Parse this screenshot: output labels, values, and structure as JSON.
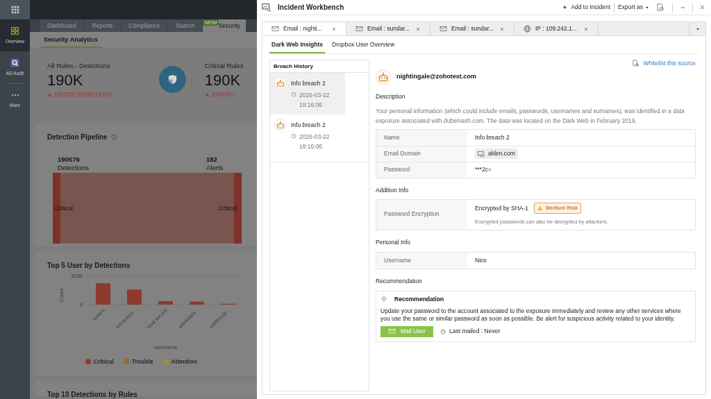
{
  "sidebar": {
    "items": [
      {
        "kind": "grid",
        "label": "Overview",
        "selected": true
      },
      {
        "kind": "audit",
        "label": "AD Audit",
        "selected": false
      },
      {
        "kind": "more",
        "label": "More",
        "selected": false
      }
    ]
  },
  "top_tabs": [
    {
      "label": "Dashboard",
      "selected": false
    },
    {
      "label": "Reports",
      "selected": false
    },
    {
      "label": "Compliance",
      "selected": false
    },
    {
      "label": "Search",
      "selected": false
    },
    {
      "label": "Security",
      "selected": true,
      "badge": "NEW"
    }
  ],
  "sub_tab": {
    "label": "Security Analytics",
    "selected": true
  },
  "kpis": [
    {
      "title": "All Rules - Detections",
      "value": "190K",
      "change": "190503 (260963.01%)"
    },
    {
      "title": "Critical Rules",
      "value": "190K",
      "change": "190489 ("
    }
  ],
  "pipeline": {
    "title": "Detection Pipeline",
    "left_count": "190576",
    "left_label": "Detections",
    "right_count": "182",
    "right_label": "Alerts",
    "left_node": "Critical",
    "right_node": "Critical"
  },
  "top_users": {
    "title": "Top 5 User by Detections",
    "chart_data": {
      "type": "bar",
      "xlabel": "Username",
      "ylabel": "Count",
      "categories": [
        "system",
        "anonymou...",
        "local service",
        "administra...",
        "o365mc@..."
      ],
      "series": [
        {
          "name": "Critical",
          "color": "#8e3a2f",
          "values": [
            2350,
            1650,
            380,
            330,
            100
          ]
        }
      ],
      "ylim": [
        0,
        3200
      ],
      "yticks": [
        0,
        3200
      ]
    },
    "legend_extra": [
      {
        "label": "Trouble",
        "color": "#9a6a2c"
      },
      {
        "label": "Attention",
        "color": "#a0902e"
      }
    ]
  },
  "next_card_title": "Top 10 Detections by Rules",
  "workbench": {
    "title": "Incident Workbench",
    "add_action": "Add to Incident",
    "export_action": "Export as",
    "entity_tabs": [
      {
        "kind": "email",
        "label": "Email : nighti...",
        "selected": true
      },
      {
        "kind": "email",
        "label": "Email : sundar...",
        "selected": false
      },
      {
        "kind": "email",
        "label": "Email : sundar...",
        "selected": false
      },
      {
        "kind": "ip",
        "label": "IP : 109.242.1...",
        "selected": false
      }
    ],
    "view_tabs": [
      {
        "label": "Dark Web Insights",
        "selected": true
      },
      {
        "label": "Dropbox User Overview",
        "selected": false
      }
    ],
    "breach_history": {
      "title": "Breach History",
      "items": [
        {
          "name": "Info breach 2",
          "time": "2026-03-22 19:16:06",
          "selected": true
        },
        {
          "name": "Info breach 2",
          "time": "2026-03-22 19:16:06",
          "selected": false
        }
      ]
    },
    "whitelist": "Whitelist this source",
    "email": "nightingale@zohotest.com",
    "description": {
      "title": "Description",
      "text": "Your personal information (which could include emails, passwords, usernames and surnames), was identified in a data exposure associated with dubsmash.com. The data was located on the Dark Web in February 2019."
    },
    "details": [
      {
        "kind": "text",
        "label": "Name",
        "value": "Info breach 2"
      },
      {
        "kind": "domain",
        "label": "Email Domain",
        "value": "aklen.com"
      },
      {
        "kind": "text",
        "label": "Password",
        "value": "***2c="
      }
    ],
    "addition_info": {
      "title": "Addition Info",
      "label": "Password Encryption",
      "value": "Encrypted by SHA-1",
      "badge": "Medium Risk",
      "note": "Encrypted passwords can also be decrypted by attackers."
    },
    "personal_info": {
      "title": "Personal Info",
      "rows": [
        {
          "label": "Username",
          "value": "Nice"
        }
      ]
    },
    "recommendation": {
      "title": "Recommendation",
      "card_title": "Recommendation",
      "text": "Update your password to the account associated to the exposure immediately and review any other services where you use the same or similar password as soon as possible. Be alert for suspicious activity related to your identity.",
      "button": "Mail User",
      "last_mailed": "Last mailed : Never"
    }
  }
}
